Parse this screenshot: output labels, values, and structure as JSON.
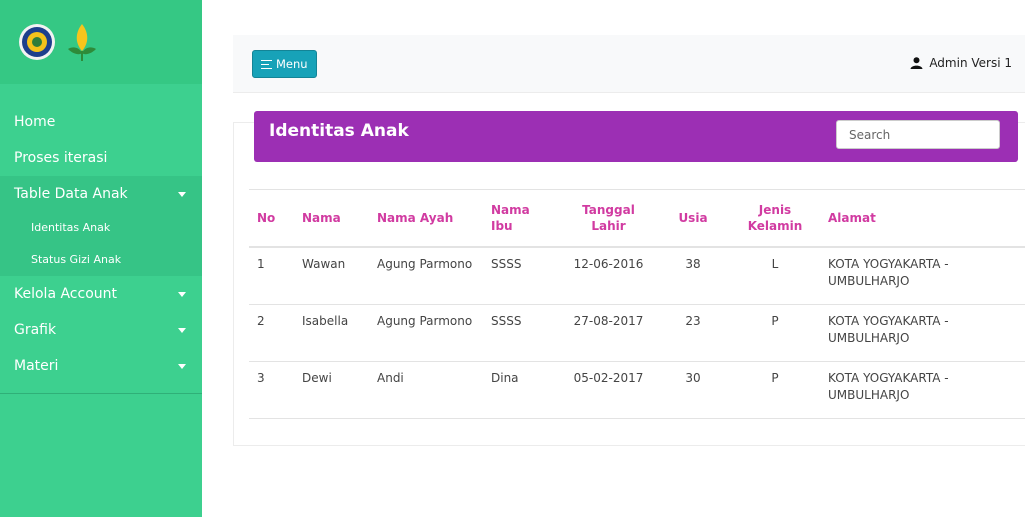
{
  "sidebar": {
    "items": [
      {
        "label": "Home"
      },
      {
        "label": "Proses iterasi"
      },
      {
        "label": "Table Data Anak"
      },
      {
        "label": "Kelola Account"
      },
      {
        "label": "Grafik"
      },
      {
        "label": "Materi"
      }
    ],
    "sub_items": [
      {
        "label": "Identitas Anak"
      },
      {
        "label": "Status Gizi Anak"
      }
    ]
  },
  "topbar": {
    "menu_label": "Menu",
    "user_name": "Admin Versi 1"
  },
  "card": {
    "title": "Identitas Anak",
    "search_placeholder": "Search"
  },
  "table": {
    "headers": [
      "No",
      "Nama",
      "Nama Ayah",
      "Nama Ibu",
      "Tanggal Lahir",
      "Usia",
      "Jenis Kelamin",
      "Alamat"
    ],
    "rows": [
      [
        "1",
        "Wawan",
        "Agung Parmono",
        "SSSS",
        "12-06-2016",
        "38",
        "L",
        "KOTA YOGYAKARTA - UMBULHARJO"
      ],
      [
        "2",
        "Isabella",
        "Agung Parmono",
        "SSSS",
        "27-08-2017",
        "23",
        "P",
        "KOTA YOGYAKARTA - UMBULHARJO"
      ],
      [
        "3",
        "Dewi",
        "Andi",
        "Dina",
        "05-02-2017",
        "30",
        "P",
        "KOTA YOGYAKARTA - UMBULHARJO"
      ]
    ]
  },
  "colors": {
    "sidebar": "#3dd08f",
    "header": "#9c2fb4",
    "header_text": "#d13ba1",
    "menu_button": "#17a2b8"
  }
}
